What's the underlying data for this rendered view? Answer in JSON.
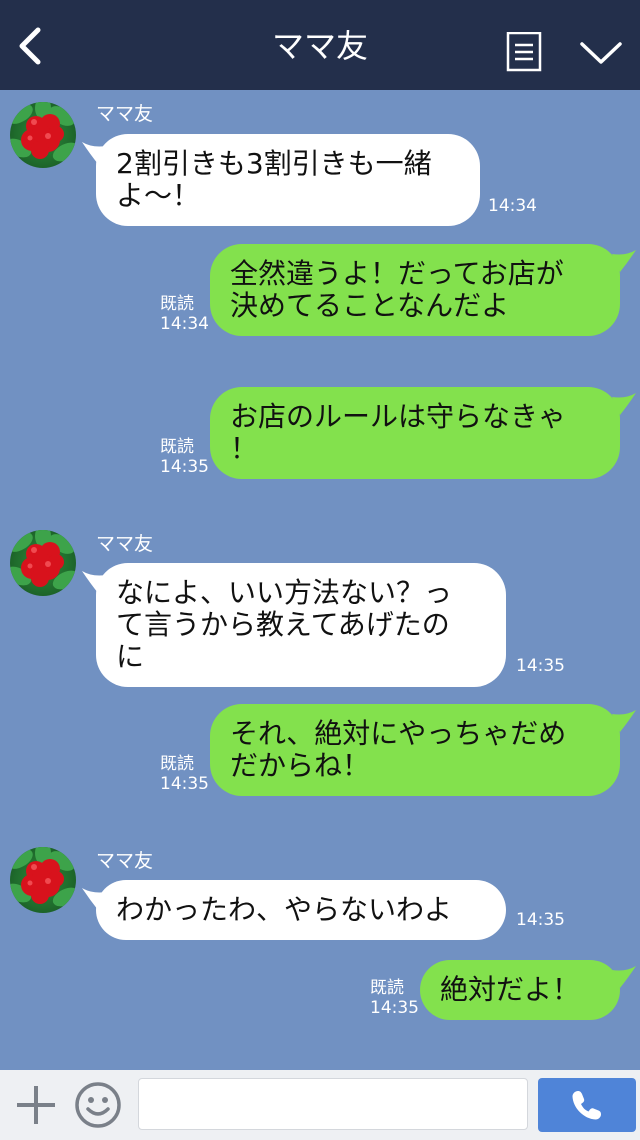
{
  "header": {
    "title": "ママ友",
    "back_icon": "chevron-left-icon",
    "menu_icon": "document-list-icon",
    "expand_icon": "chevron-down-icon"
  },
  "colors": {
    "header_bg": "#232f4b",
    "chat_bg": "#7191c2",
    "incoming_bubble": "#ffffff",
    "outgoing_bubble": "#83e14d",
    "send_button": "#4f84d8"
  },
  "messages": [
    {
      "direction": "in",
      "sender": "ママ友",
      "text": "2割引きも3割引きも一緒\nよ～！",
      "time": "14:34"
    },
    {
      "direction": "out",
      "text": "全然違うよ！だってお店が\n決めてることなんだよ",
      "read": "既読",
      "time": "14:34"
    },
    {
      "direction": "out",
      "text": "お店のルールは守らなきゃ\n！",
      "read": "既読",
      "time": "14:35"
    },
    {
      "direction": "in",
      "sender": "ママ友",
      "text": "なによ、いい方法ない？っ\nて言うから教えてあげたの\nに",
      "time": "14:35"
    },
    {
      "direction": "out",
      "text": "それ、絶対にやっちゃだめ\nだからね！",
      "read": "既読",
      "time": "14:35"
    },
    {
      "direction": "in",
      "sender": "ママ友",
      "text": "わかったわ、やらないわよ",
      "time": "14:35"
    },
    {
      "direction": "out",
      "text": "絶対だよ！",
      "read": "既読",
      "time": "14:35"
    }
  ],
  "input_bar": {
    "add_icon": "plus-icon",
    "emoji_icon": "smiley-icon",
    "input_value": "",
    "call_icon": "phone-icon"
  }
}
